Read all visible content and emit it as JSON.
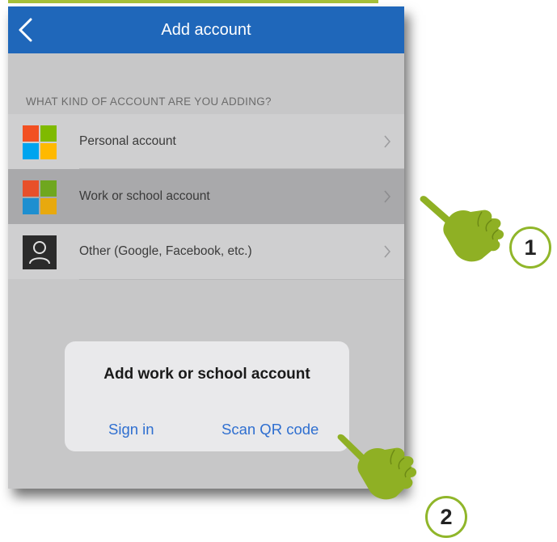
{
  "navbar": {
    "title": "Add account",
    "back_icon": "chevron-left-icon"
  },
  "section": {
    "header": "WHAT KIND OF ACCOUNT ARE YOU ADDING?"
  },
  "account_types": [
    {
      "label": "Personal account",
      "icon": "microsoft-logo-icon",
      "selected": false
    },
    {
      "label": "Work or school account",
      "icon": "microsoft-logo-icon",
      "selected": true
    },
    {
      "label": "Other (Google, Facebook, etc.)",
      "icon": "user-icon",
      "selected": false
    }
  ],
  "dialog": {
    "title": "Add work or school account",
    "sign_in_label": "Sign in",
    "scan_qr_label": "Scan QR code"
  },
  "annotations": {
    "step1": "1",
    "step2": "2"
  },
  "colors": {
    "nav_blue": "#1f67ba",
    "link_blue": "#2f6fd0",
    "accent_green": "#a6c13a",
    "ms_red": "#f25022",
    "ms_green": "#7fba00",
    "ms_blue": "#00a4ef",
    "ms_yellow": "#ffb900"
  }
}
